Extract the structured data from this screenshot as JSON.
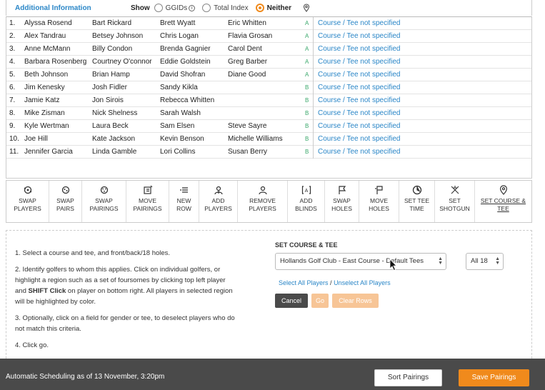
{
  "header": {
    "title": "Additional Information",
    "show_label": "Show",
    "options": [
      {
        "label": "GGIDs",
        "selected": false
      },
      {
        "label": "Total Index",
        "selected": false
      },
      {
        "label": "Neither",
        "selected": true
      }
    ]
  },
  "rows": [
    {
      "num": "1.",
      "p1": "Alyssa Rosend",
      "p2": "Bart Rickard",
      "p3": "Brett Wyatt",
      "p4": "Eric Whitten",
      "group": "A",
      "course": "Course / Tee not specified"
    },
    {
      "num": "2.",
      "p1": "Alex Tandrau",
      "p2": "Betsey Johnson",
      "p3": "Chris Logan",
      "p4": "Flavia Grosan",
      "group": "A",
      "course": "Course / Tee not specified"
    },
    {
      "num": "3.",
      "p1": "Anne McMann",
      "p2": "Billy Condon",
      "p3": "Brenda Gagnier",
      "p4": "Carol Dent",
      "group": "A",
      "course": "Course / Tee not specified"
    },
    {
      "num": "4.",
      "p1": "Barbara Rosenberg",
      "p2": "Courtney O'connor",
      "p3": "Eddie Goldstein",
      "p4": "Greg Barber",
      "group": "A",
      "course": "Course / Tee not specified"
    },
    {
      "num": "5.",
      "p1": "Beth Johnson",
      "p2": "Brian Hamp",
      "p3": "David Shofran",
      "p4": "Diane Good",
      "group": "A",
      "course": "Course / Tee not specified"
    },
    {
      "num": "6.",
      "p1": "Jim Kenesky",
      "p2": "Josh Fidler",
      "p3": "Sandy Kikla",
      "p4": "",
      "group": "B",
      "course": "Course / Tee not specified"
    },
    {
      "num": "7.",
      "p1": "Jamie Katz",
      "p2": "Jon Sirois",
      "p3": "Rebecca Whitten",
      "p4": "",
      "group": "B",
      "course": "Course / Tee not specified"
    },
    {
      "num": "8.",
      "p1": "Mike Zisman",
      "p2": "Nick Shelness",
      "p3": "Sarah Walsh",
      "p4": "",
      "group": "B",
      "course": "Course / Tee not specified"
    },
    {
      "num": "9.",
      "p1": "Kyle Wertman",
      "p2": "Laura Beck",
      "p3": "Sam Elsen",
      "p4": "Steve Sayre",
      "group": "B",
      "course": "Course / Tee not specified"
    },
    {
      "num": "10.",
      "p1": "Joe Hill",
      "p2": "Kate Jackson",
      "p3": "Kevin Benson",
      "p4": "Michelle Williams",
      "group": "B",
      "course": "Course / Tee not specified"
    },
    {
      "num": "11.",
      "p1": "Jennifer Garcia",
      "p2": "Linda Gamble",
      "p3": "Lori Collins",
      "p4": "Susan Berry",
      "group": "B",
      "course": "Course / Tee not specified"
    }
  ],
  "toolbar": [
    {
      "l1": "SWAP",
      "l2": "PLAYERS",
      "icon": "swap-players-icon"
    },
    {
      "l1": "SWAP",
      "l2": "PAIRS",
      "icon": "swap-pairs-icon"
    },
    {
      "l1": "SWAP",
      "l2": "PAIRINGS",
      "icon": "swap-pairings-icon"
    },
    {
      "l1": "MOVE",
      "l2": "PAIRINGS",
      "icon": "move-pairings-icon"
    },
    {
      "l1": "NEW",
      "l2": "ROW",
      "icon": "new-row-icon"
    },
    {
      "l1": "ADD",
      "l2": "PLAYERS",
      "icon": "add-players-icon"
    },
    {
      "l1": "REMOVE",
      "l2": "PLAYERS",
      "icon": "remove-players-icon"
    },
    {
      "l1": "ADD",
      "l2": "BLINDS",
      "icon": "add-blinds-icon"
    },
    {
      "l1": "SWAP",
      "l2": "HOLES",
      "icon": "swap-holes-icon"
    },
    {
      "l1": "MOVE",
      "l2": "HOLES",
      "icon": "move-holes-icon"
    },
    {
      "l1": "SET TEE",
      "l2": "TIME",
      "icon": "clock-icon"
    },
    {
      "l1": "SET",
      "l2": "SHOTGUN",
      "icon": "shotgun-icon"
    },
    {
      "l1": "SET COURSE &",
      "l2": "TEE",
      "icon": "map-pin-icon"
    }
  ],
  "instructions": {
    "step1": "1. Select a course and tee, and front/back/18 holes.",
    "step2a": "2. Identify golfers to whom this applies. Click on individual golfers, or highlight a region such as a set of foursomes by clicking top left player and ",
    "step2b": "SHIFT Click",
    "step2c": " on player on bottom right. All players in selected region will be highlighted by color.",
    "step3": "3. Optionally, click on a field for gender or tee, to deselect players who do not match this criteria.",
    "step4": "4. Click go."
  },
  "course_panel": {
    "title": "SET COURSE & TEE",
    "course_select": "Hollands Golf Club - East Course - Default Tees",
    "holes_select": "All 18",
    "select_all": "Select All Players",
    "unselect_all": "Unselect All Players",
    "cancel": "Cancel",
    "go": "Go",
    "clear_rows": "Clear Rows"
  },
  "footer": {
    "status": "Automatic Scheduling as of 13 November, 3:20pm",
    "sort": "Sort Pairings",
    "save": "Save Pairings"
  },
  "colors": {
    "accent": "#f08a1c",
    "link": "#2a86c7",
    "group": "#3aa86b",
    "footer_bg": "#4a4a4a"
  }
}
